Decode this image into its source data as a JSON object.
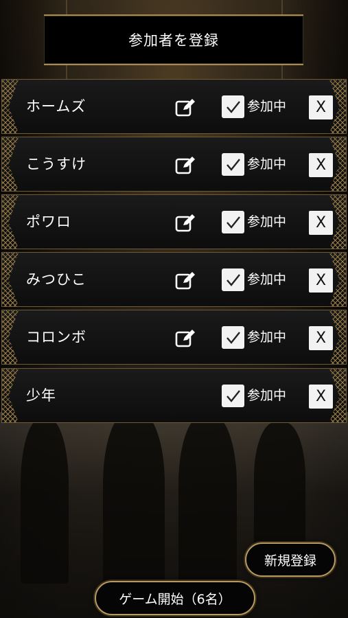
{
  "header": {
    "title": "参加者を登録"
  },
  "participants": [
    {
      "name": "ホームズ",
      "status_label": "参加中",
      "checked": true,
      "editable": true,
      "delete_label": "X"
    },
    {
      "name": "こうすけ",
      "status_label": "参加中",
      "checked": true,
      "editable": true,
      "delete_label": "X"
    },
    {
      "name": "ポワロ",
      "status_label": "参加中",
      "checked": true,
      "editable": true,
      "delete_label": "X"
    },
    {
      "name": "みつひこ",
      "status_label": "参加中",
      "checked": true,
      "editable": true,
      "delete_label": "X"
    },
    {
      "name": "コロンボ",
      "status_label": "参加中",
      "checked": true,
      "editable": true,
      "delete_label": "X"
    },
    {
      "name": "少年",
      "status_label": "参加中",
      "checked": true,
      "editable": false,
      "delete_label": "X"
    }
  ],
  "footer": {
    "new_register_label": "新規登録",
    "start_game_label": "ゲーム開始（6名）"
  },
  "icons": {
    "edit": "edit-icon",
    "check": "check-icon"
  },
  "colors": {
    "gold": "#a88a52",
    "row_bg": "#111111",
    "box_bg": "#f2f2f2"
  }
}
